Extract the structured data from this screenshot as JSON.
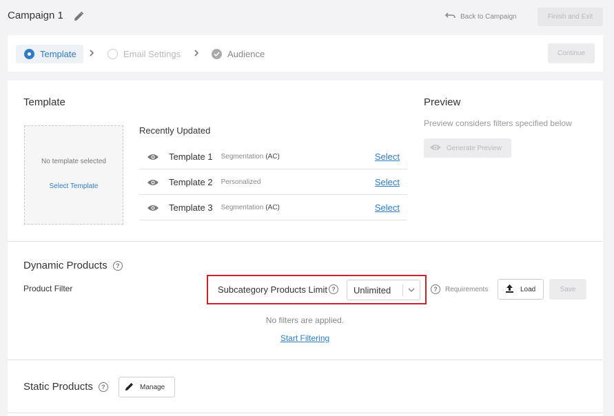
{
  "header": {
    "campaign_title": "Campaign 1",
    "back_label": "Back to Campaign",
    "finish_label": "Finish and Exit"
  },
  "stepper": {
    "steps": [
      {
        "label": "Template",
        "state": "active"
      },
      {
        "label": "Email Settings",
        "state": "pending"
      },
      {
        "label": "Audience",
        "state": "completed"
      }
    ],
    "continue_label": "Continue"
  },
  "template_section": {
    "title": "Template",
    "placeholder_text": "No template selected",
    "select_template_label": "Select Template",
    "recently_updated_title": "Recently Updated",
    "templates": [
      {
        "name": "Template 1",
        "type": "Segmentation",
        "suffix": "(AC)",
        "action": "Select"
      },
      {
        "name": "Template 2",
        "type": "Personalized",
        "suffix": "",
        "action": "Select"
      },
      {
        "name": "Template 3",
        "type": "Segmentation",
        "suffix": "(AC)",
        "action": "Select"
      }
    ]
  },
  "preview_section": {
    "title": "Preview",
    "description": "Preview considers filters specified below",
    "generate_label": "Generate Preview"
  },
  "dynamic_products": {
    "title": "Dynamic Products",
    "help": "?",
    "product_filter_label": "Product Filter",
    "subcategory_limit_label": "Subcategory Products Limit",
    "limit_value": "Unlimited",
    "requirements_label": "Requirements",
    "load_label": "Load",
    "save_label": "Save",
    "no_filters_text": "No filters are applied.",
    "start_filtering_label": "Start Filtering"
  },
  "static_products": {
    "title": "Static Products",
    "manage_label": "Manage"
  },
  "colors": {
    "accent": "#2e7cc4",
    "highlight": "#cf1f2a",
    "background": "#f3f3f5"
  }
}
